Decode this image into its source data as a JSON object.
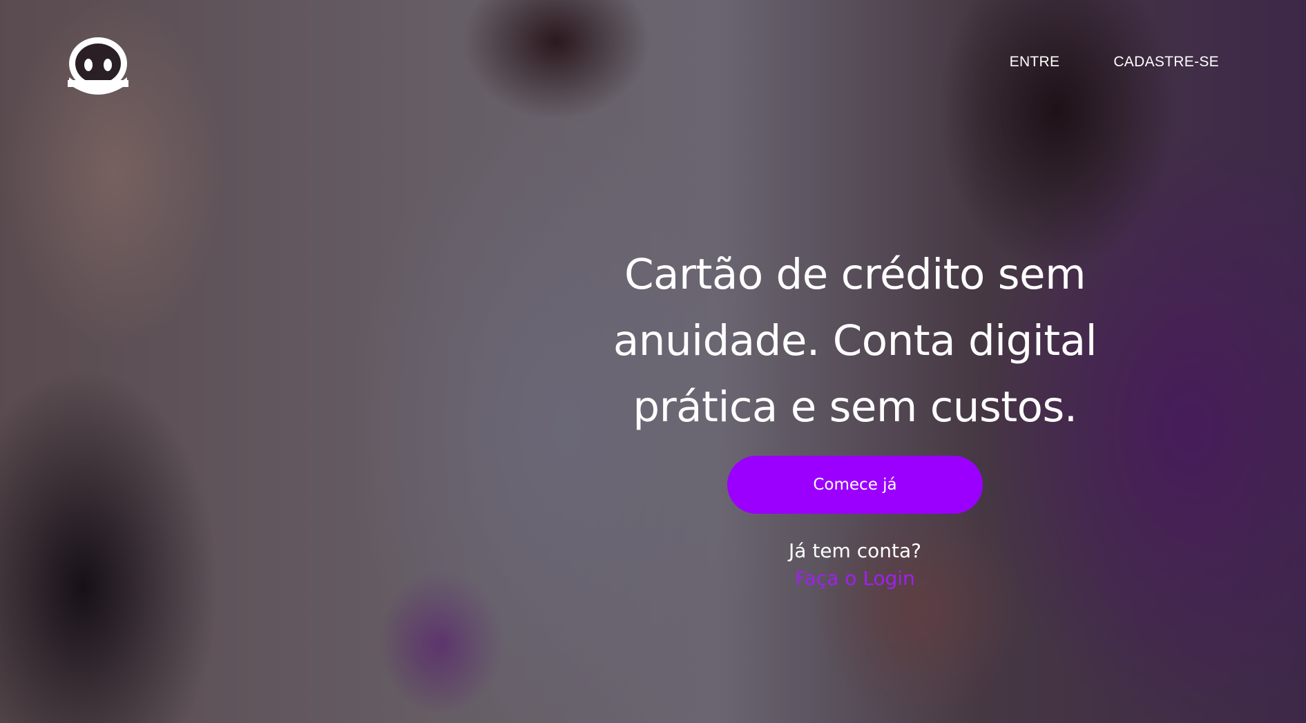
{
  "colors": {
    "accent": "#9b00ff",
    "link": "#a020f0",
    "text": "#ffffff"
  },
  "header": {
    "logo_icon": "ghost-face-icon",
    "nav": [
      {
        "label": "ENTRE"
      },
      {
        "label": "CADASTRE-SE"
      }
    ]
  },
  "hero": {
    "headline_lines": [
      "Cartão de crédito sem",
      "anuidade. Conta digital",
      "prática e sem custos."
    ],
    "cta_label": "Comece já",
    "account_question": "Já tem conta?",
    "login_link": "Faça o Login"
  }
}
